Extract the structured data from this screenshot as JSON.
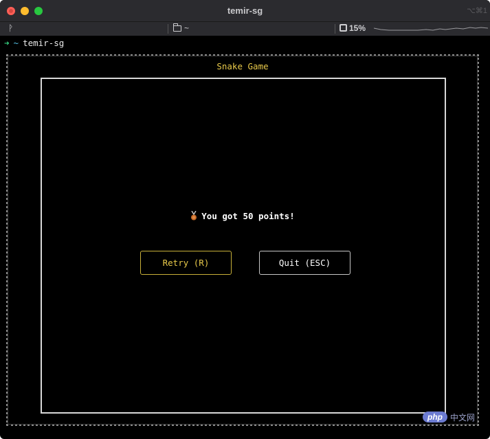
{
  "window": {
    "title": "temir-sg",
    "shortcut": "⌥⌘1"
  },
  "statusbar": {
    "branch": "ᚹ",
    "directory": "~",
    "cpu": "15%"
  },
  "prompt": {
    "arrow": "➜",
    "tilde": "~",
    "text": "temir-sg"
  },
  "game": {
    "title": "Snake Game",
    "message": "You got 50 points!",
    "retry_label": "Retry (R)",
    "quit_label": "Quit (ESC)"
  },
  "watermark": {
    "badge": "php",
    "text": "中文网"
  },
  "colors": {
    "accent_yellow": "#e8c94a",
    "prompt_green": "#35d07f",
    "prompt_cyan": "#56c3e8"
  },
  "icons": [
    "medal-icon",
    "folder-icon",
    "cpu-icon",
    "git-branch-icon"
  ]
}
